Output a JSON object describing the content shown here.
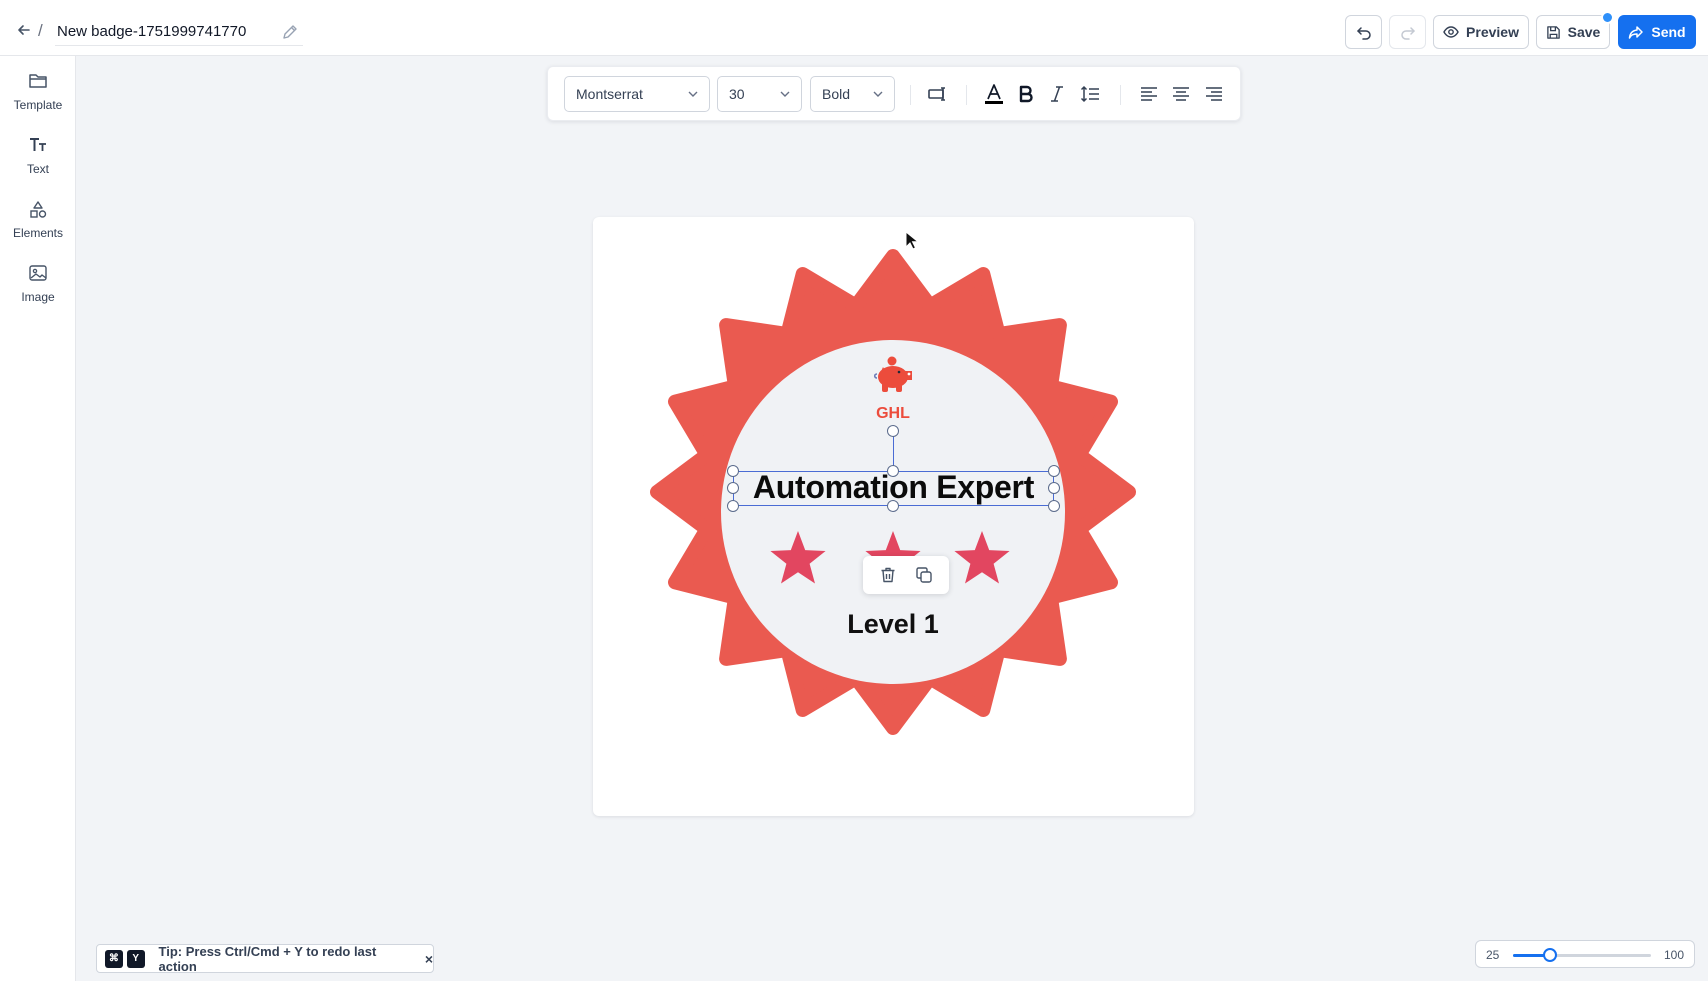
{
  "header": {
    "title": "New badge-1751999741770",
    "separator": "/",
    "preview_label": "Preview",
    "save_label": "Save",
    "send_label": "Send"
  },
  "sidebar": {
    "items": [
      {
        "label": "Template",
        "icon": "folder-icon"
      },
      {
        "label": "Text",
        "icon": "text-icon"
      },
      {
        "label": "Elements",
        "icon": "shapes-icon"
      },
      {
        "label": "Image",
        "icon": "image-icon"
      }
    ]
  },
  "toolbar": {
    "font_family": "Montserrat",
    "font_size": "30",
    "font_weight": "Bold",
    "text_color": "#000000"
  },
  "badge": {
    "logo_text": "GHL",
    "headline": "Automation Expert",
    "level": "Level 1",
    "burst_color": "#ea5a50",
    "inner_color": "#f0f2f5",
    "star_color": "#e24660",
    "logo_color": "#ec4c3c"
  },
  "tip": {
    "key1": "⌘",
    "key2": "Y",
    "text": "Tip: Press Ctrl/Cmd + Y to redo last action",
    "close": "×"
  },
  "zoom": {
    "min": "25",
    "max": "100",
    "value": 45
  }
}
